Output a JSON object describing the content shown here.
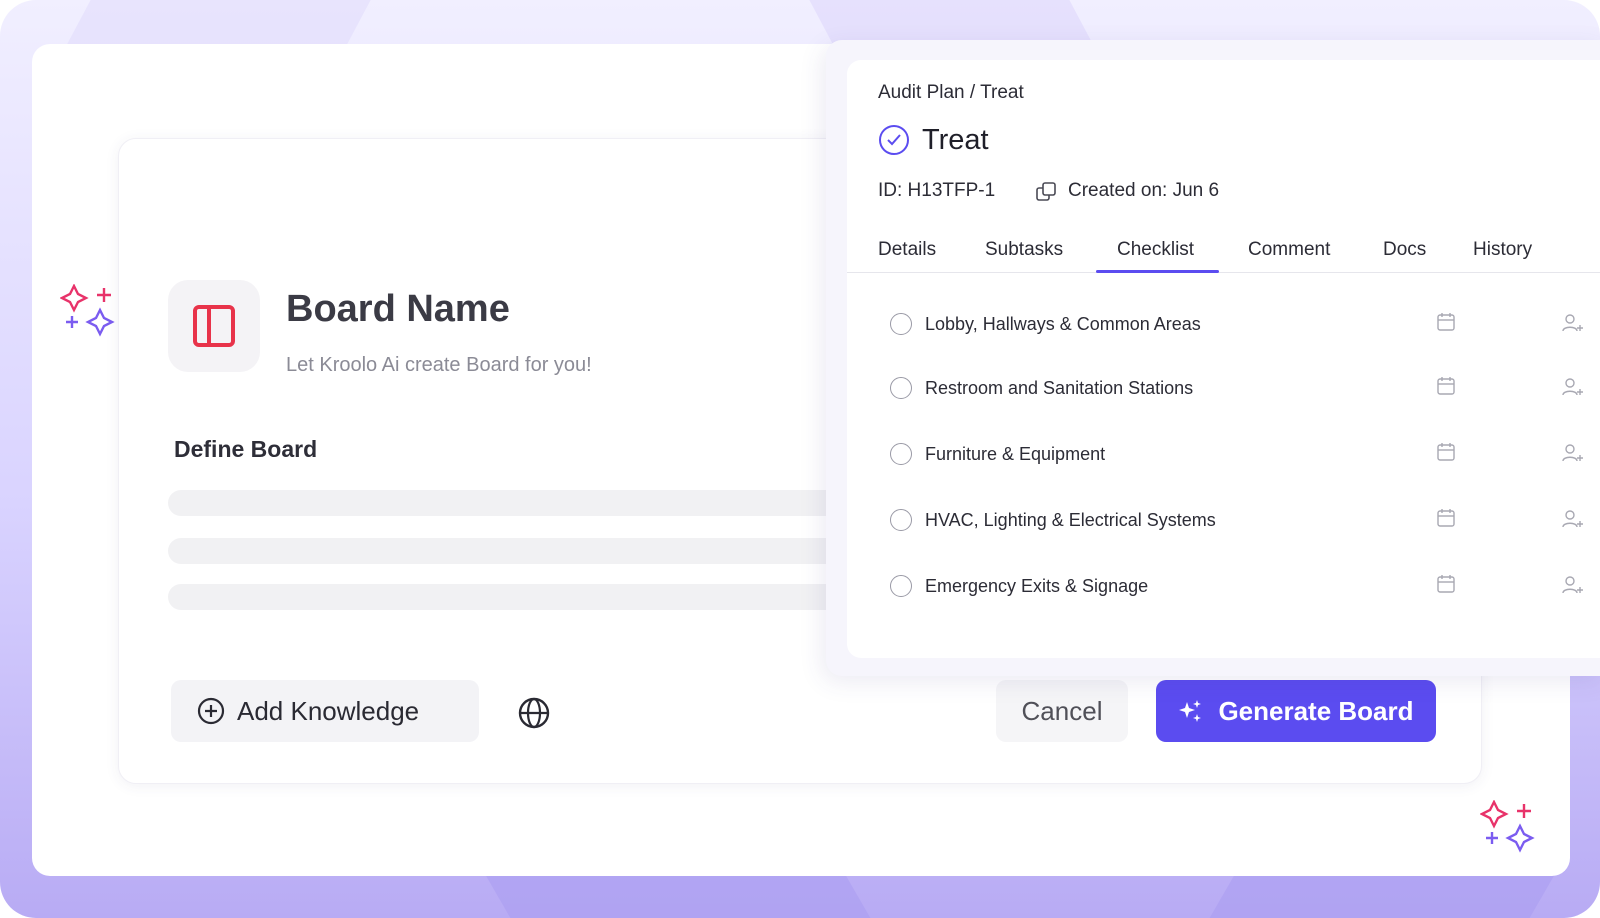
{
  "board_form": {
    "title": "Board Name",
    "subtitle": "Let Kroolo Ai create Board for you!",
    "define_label": "Define Board",
    "add_knowledge_label": "Add Knowledge",
    "cancel_label": "Cancel",
    "generate_label": "Generate Board"
  },
  "task": {
    "breadcrumb": "Audit Plan / Treat",
    "title": "Treat",
    "id_text": "ID: H13TFP-1",
    "created_text": "Created on: Jun 6",
    "tabs": [
      {
        "label": "Details"
      },
      {
        "label": "Subtasks"
      },
      {
        "label": "Checklist"
      },
      {
        "label": "Comment"
      },
      {
        "label": "Docs"
      },
      {
        "label": "History"
      }
    ],
    "active_tab": "Checklist",
    "checklist": [
      {
        "label": "Lobby, Hallways & Common Areas"
      },
      {
        "label": "Restroom and Sanitation Stations"
      },
      {
        "label": "Furniture & Equipment"
      },
      {
        "label": "HVAC, Lighting & Electrical Systems"
      },
      {
        "label": "Emergency Exits & Signage"
      }
    ]
  },
  "colors": {
    "accent": "#5b4cf0",
    "board_icon": "#e8334a",
    "sparkle_pink": "#e8336a",
    "sparkle_purple": "#7b5cf0"
  },
  "icons": {
    "board": "panel-layout-icon",
    "add": "plus-circle-icon",
    "globe": "globe-icon",
    "generate": "sparkle-icon",
    "status": "check-circle-icon",
    "copy": "copy-icon",
    "calendar": "calendar-icon",
    "assign": "add-user-icon"
  }
}
